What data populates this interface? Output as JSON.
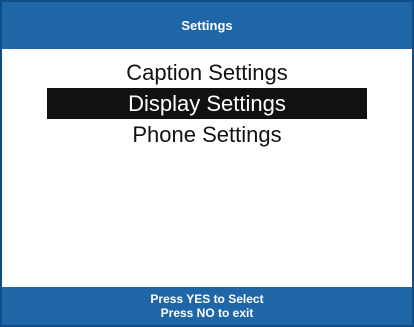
{
  "header": {
    "title": "Settings"
  },
  "menu": {
    "items": [
      {
        "label": "Caption Settings",
        "selected": false
      },
      {
        "label": "Display Settings",
        "selected": true
      },
      {
        "label": "Phone Settings",
        "selected": false
      }
    ]
  },
  "footer": {
    "line1": "Press YES to Select",
    "line2": "Press NO to exit"
  },
  "colors": {
    "accent": "#1f66a6",
    "selection_bg": "#111111",
    "selection_fg": "#ffffff",
    "background": "#ffffff"
  }
}
